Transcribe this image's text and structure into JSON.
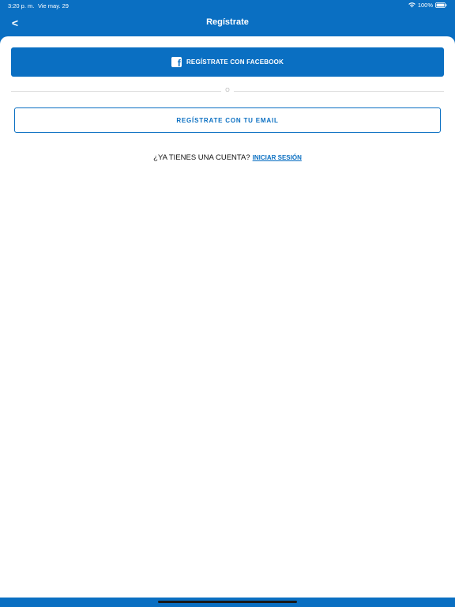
{
  "status_bar": {
    "time": "3:20 p. m.",
    "date": "Vie may. 29",
    "battery": "100%"
  },
  "nav": {
    "back_label": "<",
    "title": "Regístrate"
  },
  "facebook_button": {
    "icon": "facebook-icon",
    "label": "REGÍSTRATE CON FACEBOOK"
  },
  "divider": {
    "label": "O"
  },
  "email_button": {
    "label": "REGÍSTRATE CON TU EMAIL"
  },
  "login": {
    "question": "¿YA TIENES UNA CUENTA?",
    "link": "INICIAR SESIÓN"
  },
  "colors": {
    "brand_blue": "#0a6fc2",
    "background": "#ffffff",
    "divider": "#dcdcdc"
  }
}
